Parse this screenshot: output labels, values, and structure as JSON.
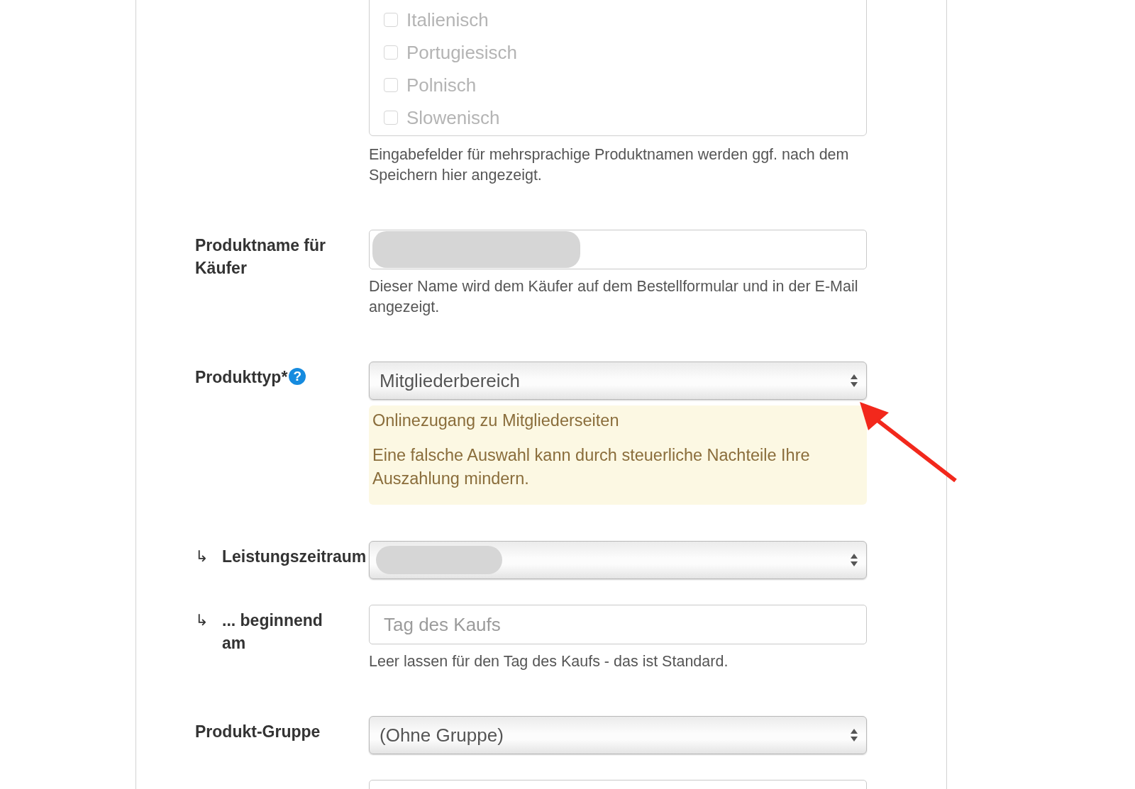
{
  "language_list": {
    "items": [
      {
        "label": "Italienisch",
        "checked": false,
        "disabled": true
      },
      {
        "label": "Portugiesisch",
        "checked": false,
        "disabled": true
      },
      {
        "label": "Polnisch",
        "checked": false,
        "disabled": true
      },
      {
        "label": "Slowenisch",
        "checked": false,
        "disabled": true
      }
    ],
    "help": "Eingabefelder für mehrsprachige Produktnamen werden ggf. nach dem Speichern hier angezeigt."
  },
  "fields": [
    {
      "kind": "input",
      "label": "Produktname für Käufer",
      "redacted": true,
      "help": "Dieser Name wird dem Käufer auf dem Bestellformular und in der E-Mail angezeigt."
    },
    {
      "kind": "select",
      "label": "Produkttyp*",
      "help_icon": "?",
      "value": "Mitgliederbereich",
      "notice": [
        "Onlinezugang zu Mitgliederseiten",
        "Eine falsche Auswahl kann durch steuerliche Nachteile Ihre Auszahlung mindern."
      ]
    },
    {
      "kind": "select",
      "marker": "↳",
      "label": "Leistungszeitraum",
      "redacted": true
    },
    {
      "kind": "input",
      "marker": "↳",
      "label": "... beginnend am",
      "placeholder": "Tag des Kaufs",
      "help": "Leer lassen für den Tag des Kaufs - das ist Standard."
    },
    {
      "kind": "select",
      "label": "Produkt-Gruppe",
      "value": "(Ohne Gruppe)"
    },
    {
      "kind": "input"
    }
  ],
  "annotations": [
    {
      "kind": "arrow"
    }
  ]
}
